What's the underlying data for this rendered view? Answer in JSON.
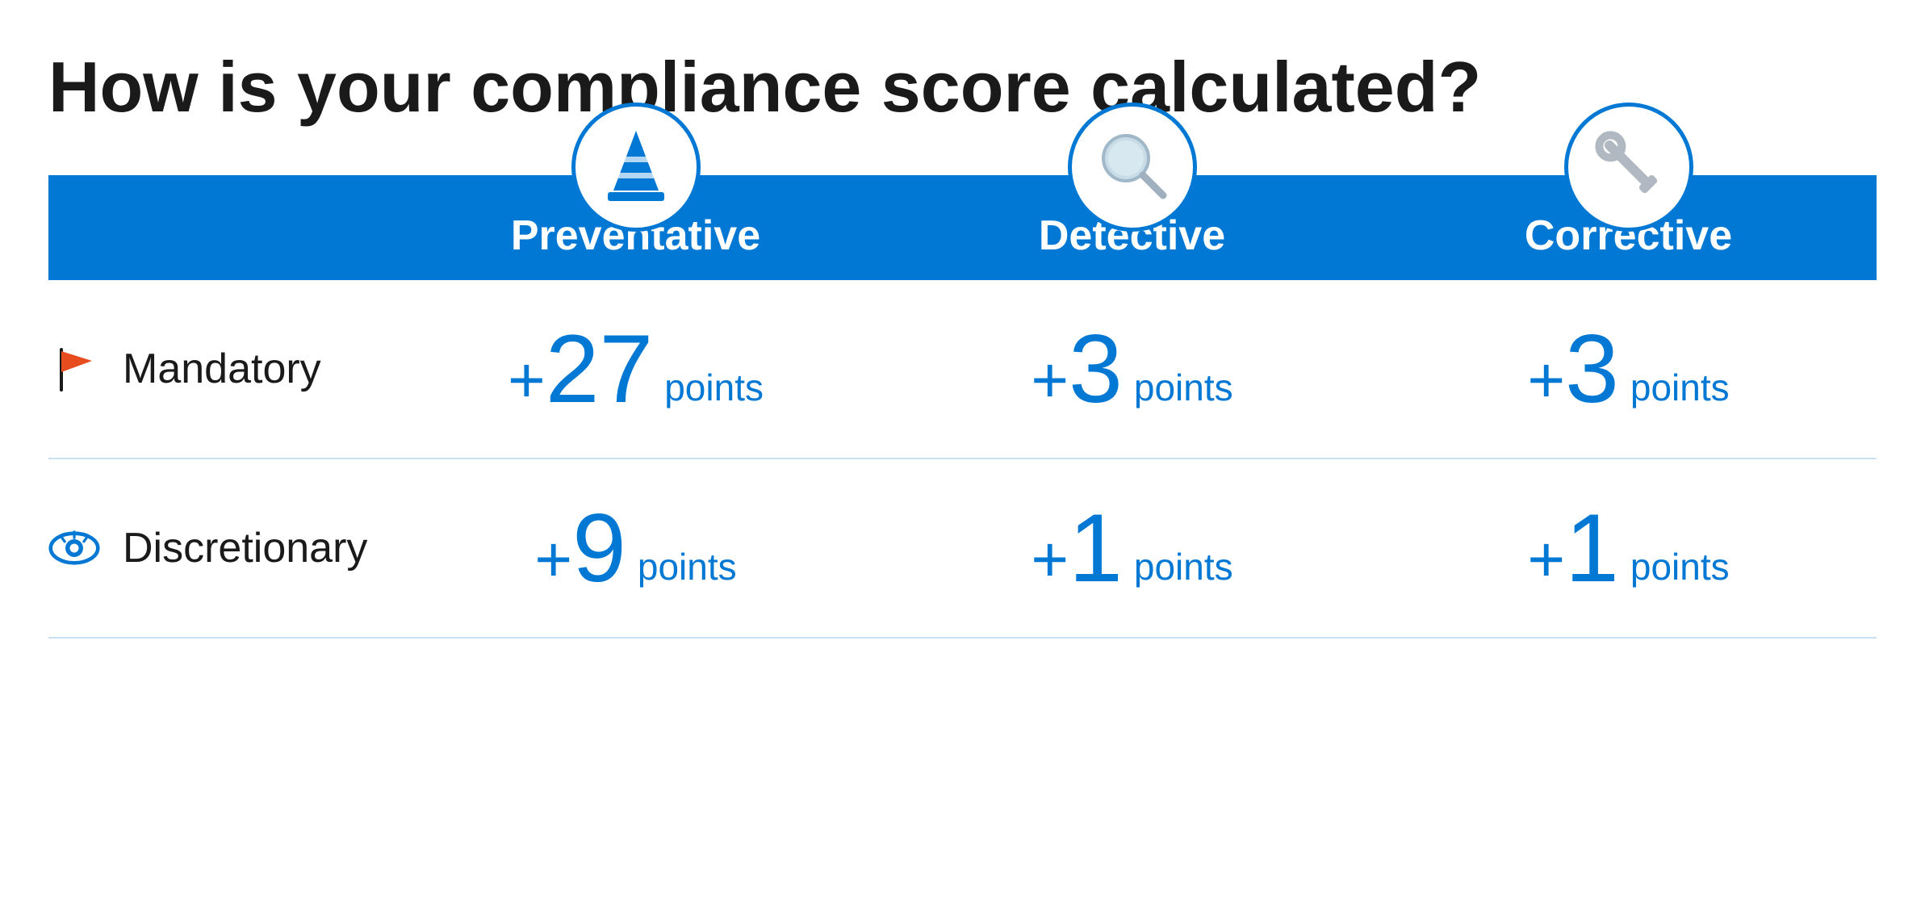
{
  "title": "How is your compliance score calculated?",
  "columns": [
    {
      "id": "preventative",
      "label": "Preventative",
      "icon": "cone"
    },
    {
      "id": "detective",
      "label": "Detective",
      "icon": "magnifier"
    },
    {
      "id": "corrective",
      "label": "Corrective",
      "icon": "wrench"
    }
  ],
  "rows": [
    {
      "id": "mandatory",
      "label": "Mandatory",
      "icon": "flag",
      "values": [
        {
          "prefix": "+",
          "number": "27",
          "unit": "points"
        },
        {
          "prefix": "+",
          "number": "3",
          "unit": "points"
        },
        {
          "prefix": "+",
          "number": "3",
          "unit": "points"
        }
      ]
    },
    {
      "id": "discretionary",
      "label": "Discretionary",
      "icon": "eye",
      "values": [
        {
          "prefix": "+",
          "number": "9",
          "unit": "points"
        },
        {
          "prefix": "+",
          "number": "1",
          "unit": "points"
        },
        {
          "prefix": "+",
          "number": "1",
          "unit": "points"
        }
      ]
    }
  ],
  "colors": {
    "accent": "#0078d4",
    "text_dark": "#1a1a1a",
    "text_white": "#ffffff",
    "border": "#c8e0f4",
    "flag_red": "#e74c1f",
    "icon_gray": "#b0b8c1"
  }
}
